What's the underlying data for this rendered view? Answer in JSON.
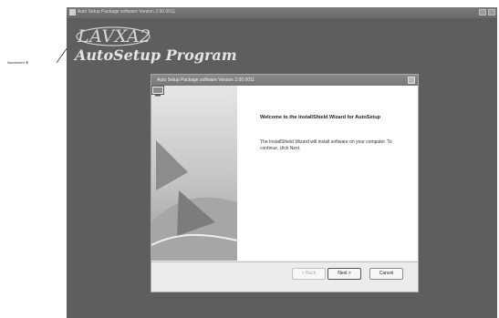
{
  "callout": {
    "label": "Numbered ⑧"
  },
  "outer_window": {
    "title": "Auto Setup Package software Version 2.00.0011"
  },
  "brand": {
    "logo_text": "LAVXA2",
    "program_title": "AutoSetup Program"
  },
  "wizard": {
    "title": "Auto Setup Package software Version 2.00.0011",
    "welcome_title": "Welcome to the InstallShield Wizard for AutoSetup",
    "welcome_desc": "The InstallShield Wizard will install software on your computer. To continue, click Next.",
    "buttons": {
      "back": "< Back",
      "next": "Next >",
      "cancel": "Cancel"
    }
  },
  "colors": {
    "desktop": "#5e5e5e",
    "wizard_bg": "#ececec",
    "panel": "#ffffff"
  }
}
